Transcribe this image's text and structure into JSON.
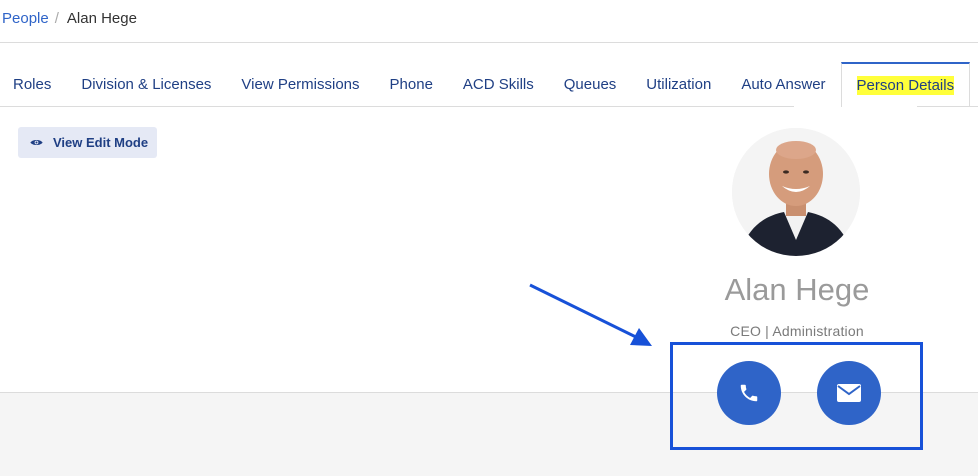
{
  "breadcrumb": {
    "parent": "People",
    "separator": "/",
    "current": "Alan Hege"
  },
  "tabs": [
    {
      "label": "Roles",
      "active": false
    },
    {
      "label": "Division & Licenses",
      "active": false
    },
    {
      "label": "View Permissions",
      "active": false
    },
    {
      "label": "Phone",
      "active": false
    },
    {
      "label": "ACD Skills",
      "active": false
    },
    {
      "label": "Queues",
      "active": false
    },
    {
      "label": "Utilization",
      "active": false
    },
    {
      "label": "Auto Answer",
      "active": false
    },
    {
      "label": "Person Details",
      "active": true
    }
  ],
  "view_mode_button": {
    "label": "View Edit Mode",
    "icon": "eye-icon"
  },
  "profile": {
    "name": "Alan Hege",
    "title": "CEO | Administration",
    "avatar": "avatar-photo"
  },
  "contact_actions": {
    "phone_icon": "phone-icon",
    "email_icon": "envelope-icon"
  },
  "colors": {
    "accent": "#2f64c8",
    "tab_text": "#1f3f84",
    "annotation_blue": "#1751d8",
    "highlight": "#ffff3a"
  }
}
